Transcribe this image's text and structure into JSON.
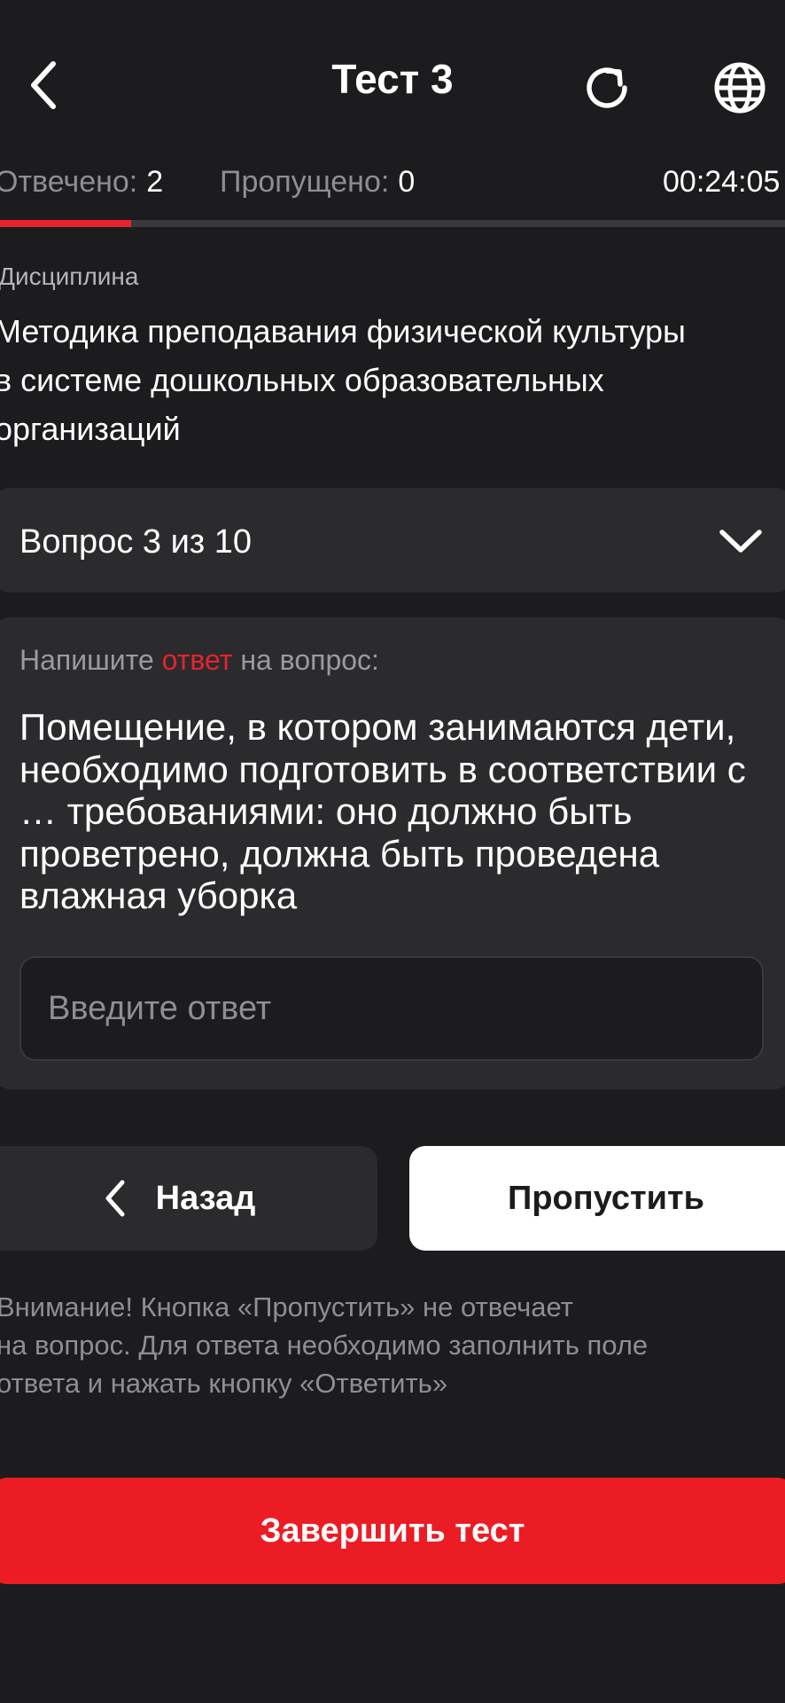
{
  "header": {
    "title": "Тест 3",
    "back_icon": "chevron-left-icon",
    "refresh_icon": "refresh-icon",
    "language_icon": "globe-icon"
  },
  "stats": {
    "answered_label": "Отвечено:",
    "answered_value": "2",
    "skipped_label": "Пропущено:",
    "skipped_value": "0",
    "timer": "00:24:05",
    "progress_fraction": 0.167
  },
  "discipline": {
    "label": "Дисциплина",
    "lines": [
      "Методика преподавания физической культуры",
      "в системе дошкольных образовательных",
      "организаций"
    ]
  },
  "question_selector": {
    "label": "Вопрос 3 из 10",
    "icon": "chevron-down-icon"
  },
  "question": {
    "hint_before": "Напишите ",
    "hint_accent": "ответ",
    "hint_after": " на вопрос:",
    "text": "Помещение, в котором занимаются дети, необходимо подготовить в соответствии с … требованиями: оно должно быть проветрено, должна быть проведена влажная уборка",
    "answer_placeholder": "Введите ответ",
    "answer_value": ""
  },
  "buttons": {
    "back": "Назад",
    "skip": "Пропустить",
    "finish": "Завершить тест"
  },
  "warning_lines": [
    "Внимание! Кнопка «Пропустить» не отвечает",
    "на вопрос. Для ответа необходимо заполнить поле",
    "ответа и нажать кнопку «Ответить»"
  ],
  "colors": {
    "background": "#1c1c1e",
    "panel": "#2b2b2d",
    "accent": "#e5232f",
    "finish_button": "#ec1c24"
  }
}
